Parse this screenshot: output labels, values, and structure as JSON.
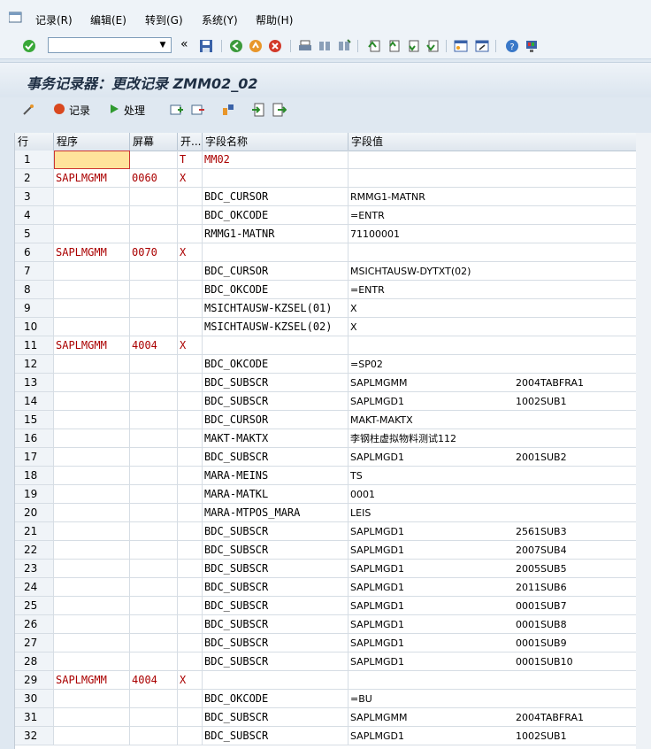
{
  "menu": {
    "items": [
      {
        "label": "记录(R)"
      },
      {
        "label": "编辑(E)"
      },
      {
        "label": "转到(G)"
      },
      {
        "label": "系统(Y)"
      },
      {
        "label": "帮助(H)"
      }
    ]
  },
  "toolbar": {
    "command_value": "",
    "back_symbol": "«"
  },
  "title": "事务记录器：更改记录 ZMM02_02",
  "app_toolbar": {
    "record_label": "记录",
    "process_label": "处理"
  },
  "grid": {
    "headers": [
      "行",
      "程序",
      "屏幕",
      "开...",
      "字段名称",
      "字段值"
    ],
    "rows": [
      {
        "line": "1",
        "program": "",
        "screen": "",
        "start": "T",
        "field": "MM02",
        "value": "",
        "value2": ""
      },
      {
        "line": "2",
        "program": "SAPLMGMM",
        "screen": "0060",
        "start": "X",
        "field": "",
        "value": "",
        "value2": ""
      },
      {
        "line": "3",
        "program": "",
        "screen": "",
        "start": "",
        "field": "BDC_CURSOR",
        "value": "RMMG1-MATNR",
        "value2": ""
      },
      {
        "line": "4",
        "program": "",
        "screen": "",
        "start": "",
        "field": "BDC_OKCODE",
        "value": "=ENTR",
        "value2": ""
      },
      {
        "line": "5",
        "program": "",
        "screen": "",
        "start": "",
        "field": "RMMG1-MATNR",
        "value": "71100001",
        "value2": ""
      },
      {
        "line": "6",
        "program": "SAPLMGMM",
        "screen": "0070",
        "start": "X",
        "field": "",
        "value": "",
        "value2": ""
      },
      {
        "line": "7",
        "program": "",
        "screen": "",
        "start": "",
        "field": "BDC_CURSOR",
        "value": "MSICHTAUSW-DYTXT(02)",
        "value2": ""
      },
      {
        "line": "8",
        "program": "",
        "screen": "",
        "start": "",
        "field": "BDC_OKCODE",
        "value": "=ENTR",
        "value2": ""
      },
      {
        "line": "9",
        "program": "",
        "screen": "",
        "start": "",
        "field": "MSICHTAUSW-KZSEL(01)",
        "value": "X",
        "value2": ""
      },
      {
        "line": "10",
        "program": "",
        "screen": "",
        "start": "",
        "field": "MSICHTAUSW-KZSEL(02)",
        "value": "X",
        "value2": ""
      },
      {
        "line": "11",
        "program": "SAPLMGMM",
        "screen": "4004",
        "start": "X",
        "field": "",
        "value": "",
        "value2": ""
      },
      {
        "line": "12",
        "program": "",
        "screen": "",
        "start": "",
        "field": "BDC_OKCODE",
        "value": "=SP02",
        "value2": ""
      },
      {
        "line": "13",
        "program": "",
        "screen": "",
        "start": "",
        "field": "BDC_SUBSCR",
        "value": "SAPLMGMM",
        "value2": "2004TABFRA1"
      },
      {
        "line": "14",
        "program": "",
        "screen": "",
        "start": "",
        "field": "BDC_SUBSCR",
        "value": "SAPLMGD1",
        "value2": "1002SUB1"
      },
      {
        "line": "15",
        "program": "",
        "screen": "",
        "start": "",
        "field": "BDC_CURSOR",
        "value": "MAKT-MAKTX",
        "value2": ""
      },
      {
        "line": "16",
        "program": "",
        "screen": "",
        "start": "",
        "field": "MAKT-MAKTX",
        "value": "李钢柱虚拟物料测试112",
        "value2": ""
      },
      {
        "line": "17",
        "program": "",
        "screen": "",
        "start": "",
        "field": "BDC_SUBSCR",
        "value": "SAPLMGD1",
        "value2": "2001SUB2"
      },
      {
        "line": "18",
        "program": "",
        "screen": "",
        "start": "",
        "field": "MARA-MEINS",
        "value": "TS",
        "value2": ""
      },
      {
        "line": "19",
        "program": "",
        "screen": "",
        "start": "",
        "field": "MARA-MATKL",
        "value": "0001",
        "value2": ""
      },
      {
        "line": "20",
        "program": "",
        "screen": "",
        "start": "",
        "field": "MARA-MTPOS_MARA",
        "value": "LEIS",
        "value2": ""
      },
      {
        "line": "21",
        "program": "",
        "screen": "",
        "start": "",
        "field": "BDC_SUBSCR",
        "value": "SAPLMGD1",
        "value2": "2561SUB3"
      },
      {
        "line": "22",
        "program": "",
        "screen": "",
        "start": "",
        "field": "BDC_SUBSCR",
        "value": "SAPLMGD1",
        "value2": "2007SUB4"
      },
      {
        "line": "23",
        "program": "",
        "screen": "",
        "start": "",
        "field": "BDC_SUBSCR",
        "value": "SAPLMGD1",
        "value2": "2005SUB5"
      },
      {
        "line": "24",
        "program": "",
        "screen": "",
        "start": "",
        "field": "BDC_SUBSCR",
        "value": "SAPLMGD1",
        "value2": "2011SUB6"
      },
      {
        "line": "25",
        "program": "",
        "screen": "",
        "start": "",
        "field": "BDC_SUBSCR",
        "value": "SAPLMGD1",
        "value2": "0001SUB7"
      },
      {
        "line": "26",
        "program": "",
        "screen": "",
        "start": "",
        "field": "BDC_SUBSCR",
        "value": "SAPLMGD1",
        "value2": "0001SUB8"
      },
      {
        "line": "27",
        "program": "",
        "screen": "",
        "start": "",
        "field": "BDC_SUBSCR",
        "value": "SAPLMGD1",
        "value2": "0001SUB9"
      },
      {
        "line": "28",
        "program": "",
        "screen": "",
        "start": "",
        "field": "BDC_SUBSCR",
        "value": "SAPLMGD1",
        "value2": "0001SUB10"
      },
      {
        "line": "29",
        "program": "SAPLMGMM",
        "screen": "4004",
        "start": "X",
        "field": "",
        "value": "",
        "value2": ""
      },
      {
        "line": "30",
        "program": "",
        "screen": "",
        "start": "",
        "field": "BDC_OKCODE",
        "value": "=BU",
        "value2": ""
      },
      {
        "line": "31",
        "program": "",
        "screen": "",
        "start": "",
        "field": "BDC_SUBSCR",
        "value": "SAPLMGMM",
        "value2": "2004TABFRA1"
      },
      {
        "line": "32",
        "program": "",
        "screen": "",
        "start": "",
        "field": "BDC_SUBSCR",
        "value": "SAPLMGD1",
        "value2": "1002SUB1"
      }
    ]
  },
  "colors": {
    "dynpro_text": "#aa0000",
    "selection_fill": "#ffe39b",
    "title_text": "#1f2f44"
  }
}
